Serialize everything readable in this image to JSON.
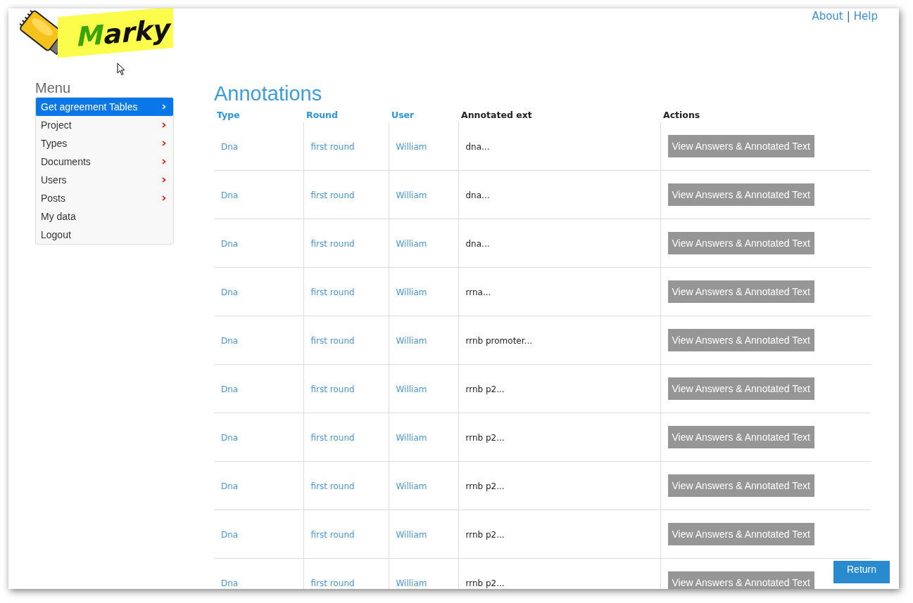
{
  "logo": {
    "text": "Marky"
  },
  "top_links": [
    {
      "label": "About"
    },
    {
      "label": "Help"
    }
  ],
  "top_links_separator": "|",
  "menu": {
    "title": "Menu",
    "items": [
      {
        "label": "Get agreement Tables",
        "selected": true,
        "has_submenu": true
      },
      {
        "label": "Project",
        "selected": false,
        "has_submenu": true
      },
      {
        "label": "Types",
        "selected": false,
        "has_submenu": true
      },
      {
        "label": "Documents",
        "selected": false,
        "has_submenu": true
      },
      {
        "label": "Users",
        "selected": false,
        "has_submenu": true
      },
      {
        "label": "Posts",
        "selected": false,
        "has_submenu": true
      },
      {
        "label": "My data",
        "selected": false,
        "has_submenu": false
      },
      {
        "label": "Logout",
        "selected": false,
        "has_submenu": false
      }
    ]
  },
  "page_title": "Annotations",
  "table": {
    "columns": [
      {
        "label": "Type",
        "sortable": true
      },
      {
        "label": "Round",
        "sortable": true
      },
      {
        "label": "User",
        "sortable": true
      },
      {
        "label": "Annotated ext",
        "sortable": false
      },
      {
        "label": "Actions",
        "sortable": false
      }
    ],
    "rows": [
      {
        "type": "Dna",
        "round": "first round",
        "user": "William",
        "text": "dna...",
        "action": "View Answers & Annotated Text"
      },
      {
        "type": "Dna",
        "round": "first round",
        "user": "William",
        "text": "dna...",
        "action": "View Answers & Annotated Text"
      },
      {
        "type": "Dna",
        "round": "first round",
        "user": "William",
        "text": "dna...",
        "action": "View Answers & Annotated Text"
      },
      {
        "type": "Dna",
        "round": "first round",
        "user": "William",
        "text": "rrna...",
        "action": "View Answers & Annotated Text"
      },
      {
        "type": "Dna",
        "round": "first round",
        "user": "William",
        "text": "rrnb promoter...",
        "action": "View Answers & Annotated Text"
      },
      {
        "type": "Dna",
        "round": "first round",
        "user": "William",
        "text": "rrnb p2...",
        "action": "View Answers & Annotated Text"
      },
      {
        "type": "Dna",
        "round": "first round",
        "user": "William",
        "text": "rrnb p2...",
        "action": "View Answers & Annotated Text"
      },
      {
        "type": "Dna",
        "round": "first round",
        "user": "William",
        "text": "rrnb p2...",
        "action": "View Answers & Annotated Text"
      },
      {
        "type": "Dna",
        "round": "first round",
        "user": "William",
        "text": "rrnb p2...",
        "action": "View Answers & Annotated Text"
      },
      {
        "type": "Dna",
        "round": "first round",
        "user": "William",
        "text": "rrnb p2...",
        "action": "View Answers & Annotated Text"
      }
    ]
  },
  "return_button": "Return"
}
